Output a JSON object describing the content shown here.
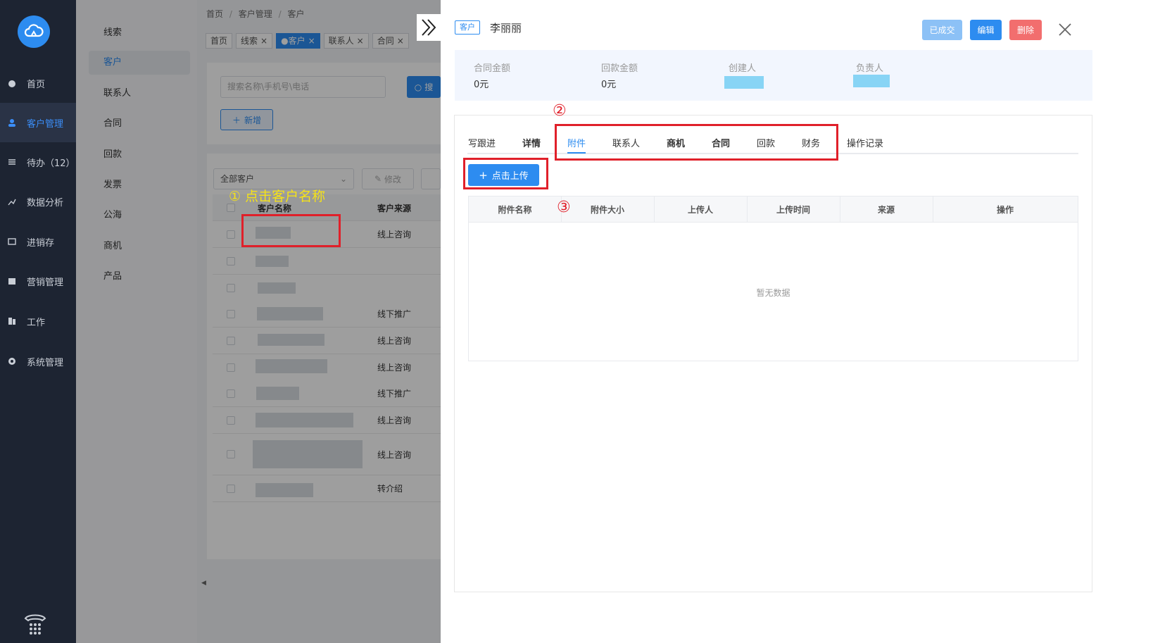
{
  "nav": {
    "items": [
      {
        "label": "首页",
        "icon": "dashboard-icon"
      },
      {
        "label": "客户管理",
        "icon": "user-icon"
      },
      {
        "label": "待办（12）",
        "icon": "todo-icon"
      },
      {
        "label": "数据分析",
        "icon": "chart-icon"
      },
      {
        "label": "进销存",
        "icon": "inventory-icon"
      },
      {
        "label": "营销管理",
        "icon": "marketing-icon"
      },
      {
        "label": "工作",
        "icon": "work-icon"
      },
      {
        "label": "系统管理",
        "icon": "gear-icon"
      }
    ],
    "active_index": 1
  },
  "submenu": {
    "items": [
      "线索",
      "客户",
      "联系人",
      "合同",
      "回款",
      "发票",
      "公海",
      "商机",
      "产品"
    ],
    "active_index": 1
  },
  "breadcrumb": {
    "home": "首页",
    "sep": "/",
    "mid": "客户管理",
    "current": "客户"
  },
  "page_tabs": [
    {
      "label": "首页",
      "closable": false,
      "active": false
    },
    {
      "label": "线索",
      "closable": true,
      "active": false
    },
    {
      "label": "●客户",
      "closable": true,
      "active": true
    },
    {
      "label": "联系人",
      "closable": true,
      "active": false
    },
    {
      "label": "合同",
      "closable": true,
      "active": false
    }
  ],
  "toolbar": {
    "search_placeholder": "搜索名称\\手机号\\电话",
    "search_button": "搜",
    "add_button": "新增",
    "filter_select": "全部客户",
    "edit_button": "修改"
  },
  "table": {
    "headers": [
      "客户名称",
      "客户来源"
    ],
    "sources": [
      "线上咨询",
      "",
      "",
      "线下推广",
      "线上咨询",
      "线上咨询",
      "线下推广",
      "线上咨询",
      "线上咨询",
      "转介绍"
    ]
  },
  "annotations": {
    "step1": "① 点击客户名称",
    "step2": "②",
    "step3": "③"
  },
  "drawer": {
    "tag": "客户",
    "name": "李丽丽",
    "btn_deal": "已成交",
    "btn_edit": "编辑",
    "btn_delete": "删除",
    "summary": [
      {
        "label": "合同金额",
        "value": "0元"
      },
      {
        "label": "回款金额",
        "value": "0元"
      },
      {
        "label": "创建人",
        "value": ""
      },
      {
        "label": "负责人",
        "value": ""
      }
    ],
    "tabs": [
      "写跟进",
      "详情",
      "附件",
      "联系人",
      "商机",
      "合同",
      "回款",
      "财务",
      "操作记录"
    ],
    "active_tab": "附件",
    "upload_button": "点击上传",
    "columns": [
      "附件名称",
      "附件大小",
      "上传人",
      "上传时间",
      "来源",
      "操作"
    ],
    "empty_text": "暂无数据"
  },
  "colors": {
    "primary": "#2d8cf0",
    "sidebar_bg": "#1d2432",
    "annotation_red": "#e0202a",
    "annotation_yellow": "#f5e218",
    "deal_button": "#8cc1f6",
    "delete_button": "#f26e6e"
  }
}
